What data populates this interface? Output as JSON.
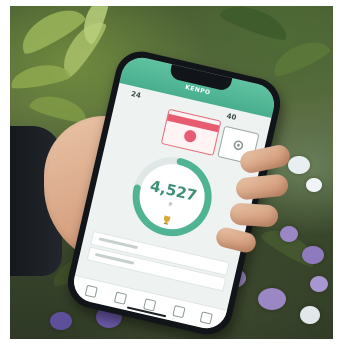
{
  "scene": {
    "description_tag": "photo",
    "app": {
      "header_title": "KENPO",
      "left_stat": "24",
      "right_stat": "40",
      "step_count": "4,527",
      "step_unit": "歩",
      "accent_color": "#4fb394",
      "card_color": "#e85c72"
    }
  }
}
